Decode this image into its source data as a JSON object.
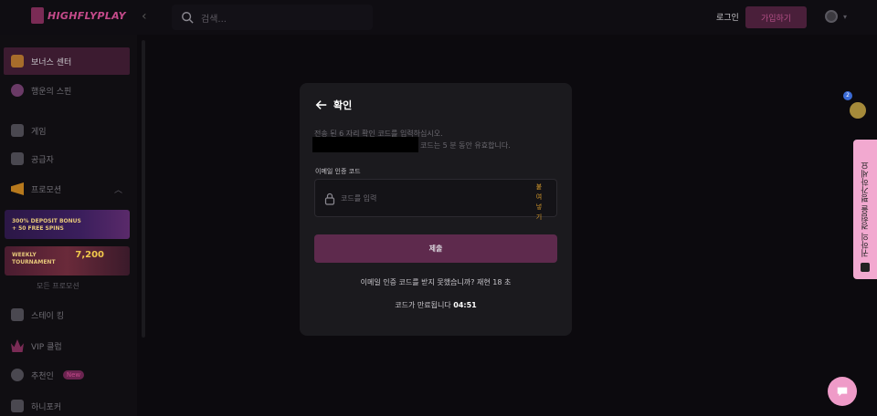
{
  "header": {
    "logo_text": "HIGHFLYPLAY",
    "search_placeholder": "검색...",
    "login_label": "로그인",
    "signup_label": "가입하기"
  },
  "sidebar": {
    "items": [
      {
        "label": "보너스 센터",
        "icon": "gift-icon",
        "active": true
      },
      {
        "label": "행운의 스핀",
        "icon": "wheel-icon",
        "active": false
      },
      {
        "label": "게임",
        "icon": "gamepad-icon",
        "active": false
      },
      {
        "label": "공급자",
        "icon": "partners-icon",
        "active": false
      },
      {
        "label": "프로모션",
        "icon": "megaphone-icon",
        "active": false
      },
      {
        "label": "스테이 킹",
        "icon": "stake-icon",
        "active": false
      },
      {
        "label": "VIP 클럽",
        "icon": "crown-icon",
        "active": false
      },
      {
        "label": "추천인",
        "icon": "referral-icon",
        "active": false,
        "badge": "New"
      },
      {
        "label": "하니포커",
        "icon": "poker-icon",
        "active": false
      }
    ],
    "banners": [
      {
        "line1": "300% DEPOSIT BONUS",
        "line2": "+ 50 FREE SPINS"
      },
      {
        "line1": "WEEKLY",
        "line2": "TOURNAMENT",
        "amount": "7,200"
      }
    ],
    "all_promotions_label": "모든 프로모션"
  },
  "modal": {
    "title": "확인",
    "instruction_line1": "전송 된 6 자리 확인 코드를 입력하십시오.",
    "instruction_line2": "코드는 5 분 동안 유효합니다.",
    "field_label": "이메일 인증 코드",
    "code_placeholder": "코드를 입력",
    "paste_label": "붙여넣기",
    "submit_label": "제출",
    "resend_text": "이메일 인증 코드를 받지 못했습니까? 재현 18 초",
    "expire_text": "코드가 만료됩니다",
    "expire_time": "04:51"
  },
  "right": {
    "avatar_badge": "2",
    "feedback_label": "귀하의 경험을 평가하세요"
  },
  "colors": {
    "accent": "#c44a8a",
    "submit_bg": "#5e2a4d",
    "feedback_bg": "#f2a9d0"
  }
}
